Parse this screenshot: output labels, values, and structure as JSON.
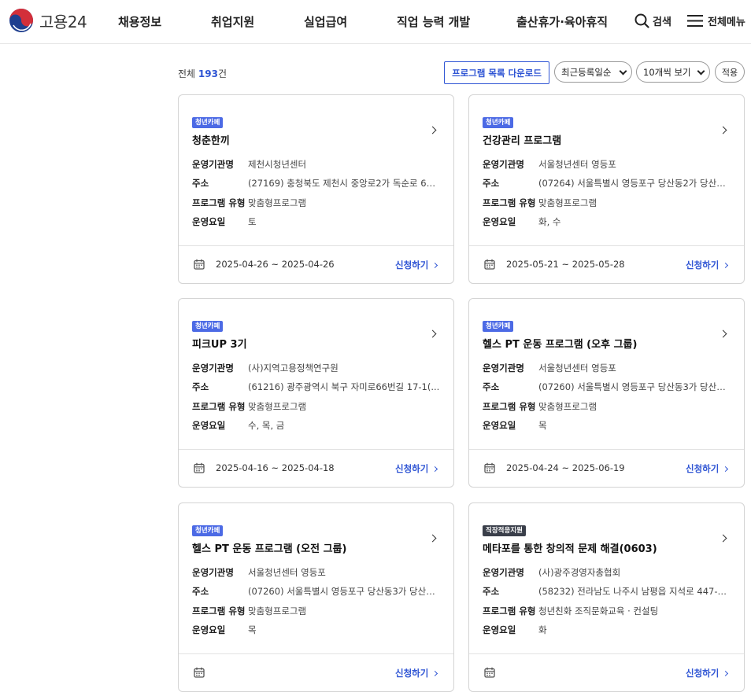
{
  "header": {
    "logo_text": "고용24",
    "nav": [
      "채용정보",
      "취업지원",
      "실업급여",
      "직업 능력 개발",
      "출산휴가·육아휴직"
    ],
    "search_label": "검색",
    "menu_label": "전체메뉴"
  },
  "toolbar": {
    "total_prefix": "전체 ",
    "total_count": "193",
    "total_suffix": "건",
    "download_label": "프로그램 목록 다운로드",
    "sort_selected": "최근등록일순",
    "page_size_selected": "10개씩 보기",
    "apply_label": "적용"
  },
  "labels": {
    "org": "운영기관명",
    "address": "주소",
    "type": "프로그램 유형",
    "days": "운영요일",
    "apply": "신청하기"
  },
  "cards": [
    {
      "badge": "청년카페",
      "title": "청춘한끼",
      "org": "제천시청년센터",
      "address": "(27169) 충청북도 제천시 중앙로2가 독순로 65(...",
      "type": "맞춤형프로그램",
      "days": "토",
      "period": "2025-04-26 ~ 2025-04-26"
    },
    {
      "badge": "청년카페",
      "title": "건강관리 프로그램",
      "org": "서울청년센터 영등포",
      "address": "(07264) 서울특별시 영등포구 당산동2가 당산로...",
      "type": "맞춤형프로그램",
      "days": "화, 수",
      "period": "2025-05-21 ~ 2025-05-28"
    },
    {
      "badge": "청년카페",
      "title": "피크UP 3기",
      "org": "(사)지역고용정책연구원",
      "address": "(61216) 광주광역시 북구 자미로66번길 17-1(...",
      "type": "맞춤형프로그램",
      "days": "수, 목, 금",
      "period": "2025-04-16 ~ 2025-04-18"
    },
    {
      "badge": "청년카페",
      "title": "헬스 PT 운동 프로그램 (오후 그룹)",
      "org": "서울청년센터 영등포",
      "address": "(07260) 서울특별시 영등포구 당산동3가 당산로...",
      "type": "맞춤형프로그램",
      "days": "목",
      "period": "2025-04-24 ~ 2025-06-19"
    },
    {
      "badge": "청년카페",
      "title": "헬스 PT 운동 프로그램 (오전 그룹)",
      "org": "서울청년센터 영등포",
      "address": "(07260) 서울특별시 영등포구 당산동3가 당산로...",
      "type": "맞춤형프로그램",
      "days": "목",
      "period": ""
    },
    {
      "badge": "직장적응지원",
      "title": "메타포를 통한 창의적 문제 해결(0603)",
      "org": "(사)광주경영자총협회",
      "address": "(58232) 전라남도 나주시 남평읍 지석로 447-1...",
      "type": "청년친화 조직문화교육 · 컨설팅",
      "days": "화",
      "period": ""
    }
  ],
  "colors": {
    "accent": "#2f55d4",
    "badge": "#4c6ae5",
    "badge_dark": "#3a3f4a"
  }
}
